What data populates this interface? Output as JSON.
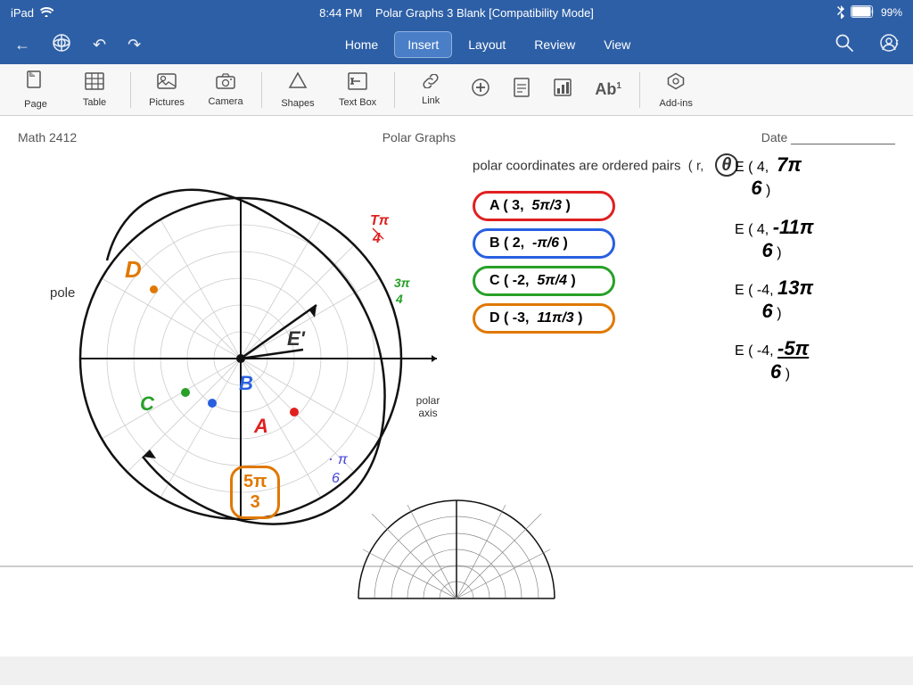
{
  "status_bar": {
    "left": "iPad",
    "wifi_icon": "wifi",
    "time": "8:44 PM",
    "title": "Polar Graphs 3 Blank [Compatibility Mode]",
    "bluetooth_icon": "bluetooth",
    "battery": "99%"
  },
  "nav": {
    "tabs": [
      "Home",
      "Insert",
      "Layout",
      "Review",
      "View"
    ],
    "active_tab": "Insert"
  },
  "toolbar": {
    "items": [
      {
        "name": "page",
        "label": "Page",
        "icon": "📄"
      },
      {
        "name": "table",
        "label": "Table",
        "icon": "⊞"
      },
      {
        "name": "pictures",
        "label": "Pictures",
        "icon": "🖼"
      },
      {
        "name": "camera",
        "label": "Camera",
        "icon": "📷"
      },
      {
        "name": "shapes",
        "label": "Shapes",
        "icon": "⬡"
      },
      {
        "name": "textbox",
        "label": "Text Box",
        "icon": "⬜"
      },
      {
        "name": "link",
        "label": "Link",
        "icon": "🔗"
      },
      {
        "name": "plus",
        "label": "",
        "icon": "⊕"
      },
      {
        "name": "doc",
        "label": "",
        "icon": "📃"
      },
      {
        "name": "chart",
        "label": "",
        "icon": "📊"
      },
      {
        "name": "ab",
        "label": "",
        "icon": "Ab"
      },
      {
        "name": "addins",
        "label": "Add-ins",
        "icon": "⬡"
      }
    ]
  },
  "document": {
    "header_left": "Math 2412",
    "header_center": "Polar Graphs",
    "header_right": "Date _______________",
    "pole_label": "pole",
    "polar_axis_label": "polar axis",
    "title_note": "polar coordinates are ordered pairs  ( r,  θ",
    "coord_labels": {
      "A": "A ( 3,  5π/3 )",
      "B": "B ( 2,  -π/6 )",
      "C": "C ( -2,  5π/4 )",
      "D": "D ( -3,  11π/3 )"
    },
    "right_labels": [
      "E ( 4,  7π/6 )",
      "E ( 4,  -11π/6 )",
      "E ( -4,  13π/6 )",
      "E ( -4,  -5π/6 )"
    ],
    "bottom_label": "5π/3"
  },
  "colors": {
    "blue_dark": "#2d5fa6",
    "toolbar_bg": "#f7f7f7",
    "doc_bg": "#ffffff",
    "red": "#e02020",
    "green": "#28a028",
    "blue": "#2828e0",
    "orange": "#e07800",
    "purple": "#8020c0"
  }
}
